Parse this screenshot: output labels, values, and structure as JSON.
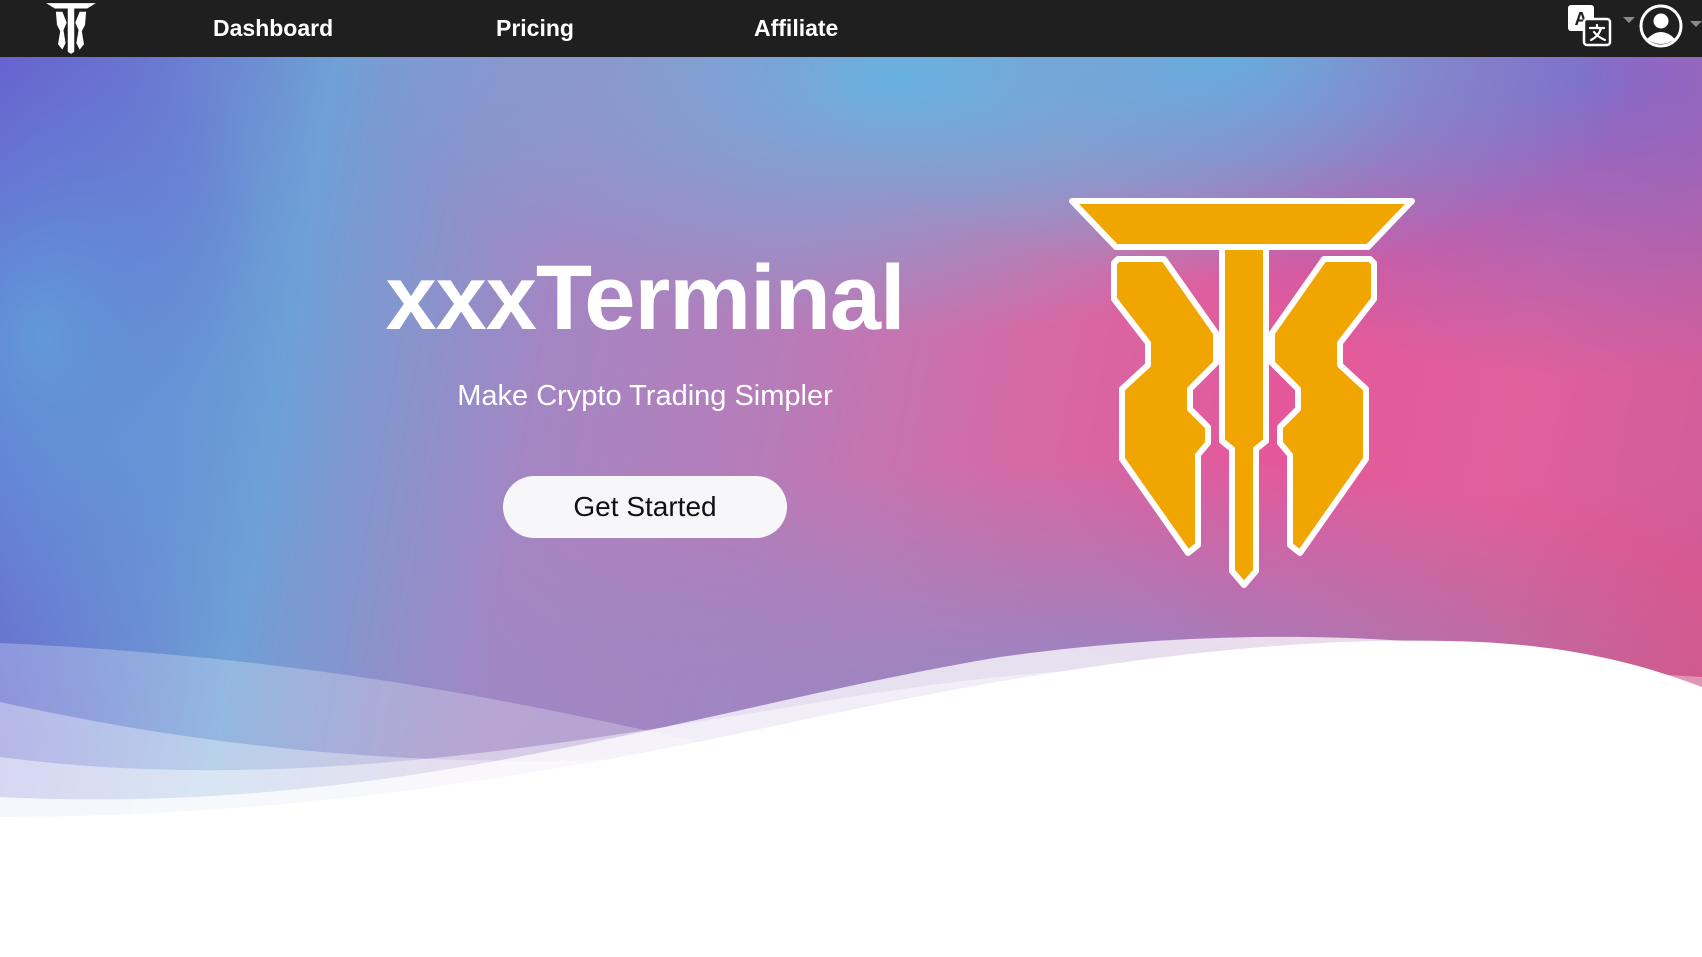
{
  "nav": {
    "logo_icon": "tt-brand-logo-icon",
    "links": [
      {
        "label": "Dashboard"
      },
      {
        "label": "Pricing"
      },
      {
        "label": "Affiliate"
      }
    ],
    "language_icon": "translate-icon",
    "user_icon": "user-account-icon"
  },
  "hero": {
    "title": "xxxTerminal",
    "subtitle": "Make Crypto Trading Simpler",
    "cta_label": "Get Started",
    "logo_icon": "tt-brand-logo-icon"
  },
  "colors": {
    "nav_background": "#1f1f1f",
    "logo_gold": "#f0a500",
    "cta_background": "#f7f7f9",
    "text_white": "#ffffff"
  }
}
